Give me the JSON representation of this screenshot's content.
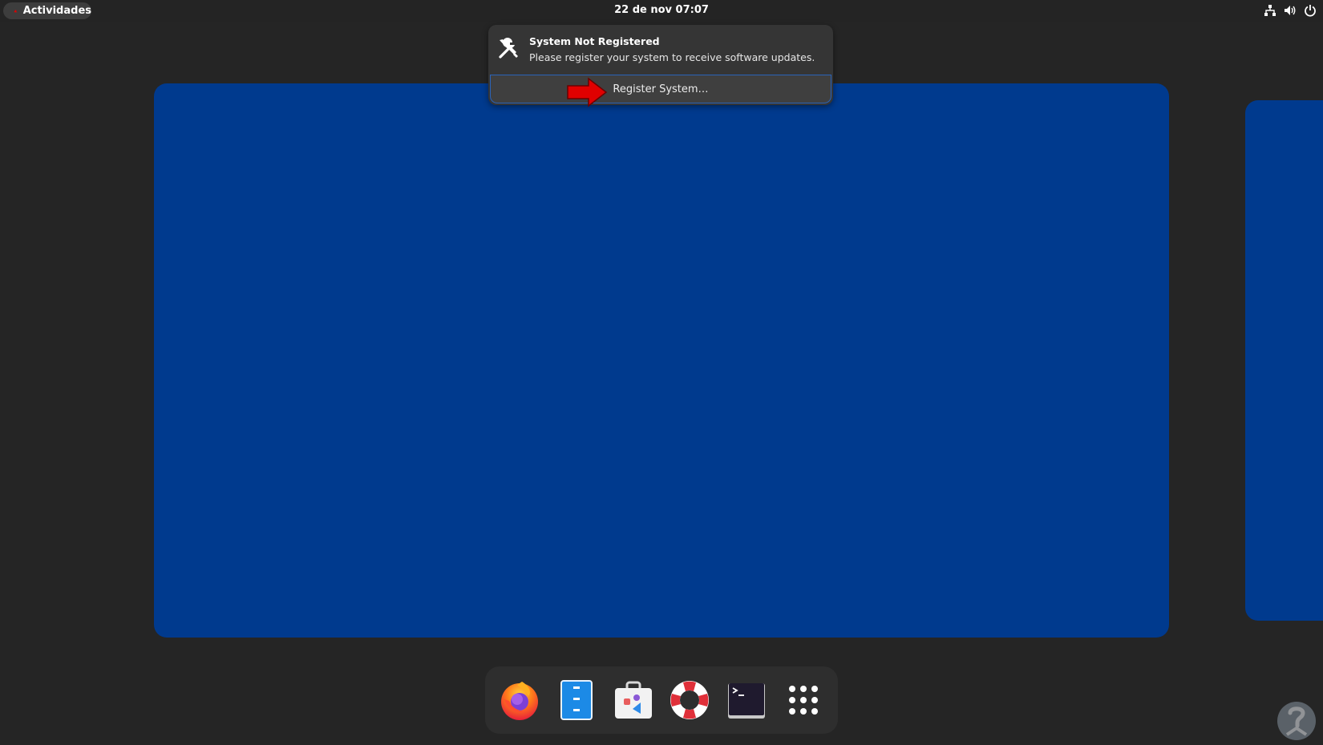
{
  "topbar": {
    "activities_label": "Actividades",
    "clock": "22 de nov  07:07",
    "tray_icons": [
      "network-icon",
      "volume-icon",
      "power-icon"
    ]
  },
  "notification": {
    "icon": "tools-icon",
    "title": "System Not Registered",
    "body": "Please register your system to receive software updates.",
    "action_label": "Register System…"
  },
  "dash": {
    "apps": [
      {
        "name": "firefox",
        "icon": "firefox-icon"
      },
      {
        "name": "files",
        "icon": "files-icon"
      },
      {
        "name": "software",
        "icon": "software-icon"
      },
      {
        "name": "help",
        "icon": "help-icon"
      },
      {
        "name": "terminal",
        "icon": "terminal-icon"
      },
      {
        "name": "show-apps",
        "icon": "app-grid-icon"
      }
    ]
  },
  "colors": {
    "background": "#252525",
    "workspace": "#003a8e",
    "notification": "#353535",
    "accent": "#2a63b8",
    "annotation_arrow": "#e00000"
  }
}
